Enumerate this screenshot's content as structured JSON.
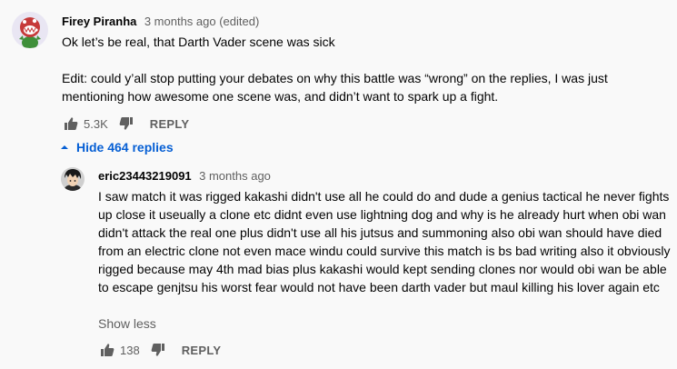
{
  "comment": {
    "author": "Firey Piranha",
    "time": "3 months ago (edited)",
    "text_lines": [
      "Ok let’s be real, that Darth Vader scene was sick",
      "Edit: could y’all stop putting your debates on why this battle was “wrong” on the replies, I was just mentioning how awesome one scene was, and didn’t want to spark up a fight."
    ],
    "likes": "5.3K",
    "reply_label": "REPLY",
    "avatar_icon": "piranha-plant-avatar"
  },
  "replies_toggle": {
    "label": "Hide 464 replies",
    "icon": "chevron-up-icon",
    "color": "#065fd4"
  },
  "reply": {
    "author": "eric23443219091",
    "time": "3 months ago",
    "text": "I saw match it was rigged kakashi didn't use all he could do and dude a genius tactical he never fights up close it useually a clone etc didnt even use lightning dog and why is he already hurt when obi wan didn't attack the real one plus didn't use all his jutsus and summoning also obi wan should have died from an electric clone not even mace windu could survive this match is bs bad writing also it obviously rigged because may 4th mad bias plus kakashi would kept sending clones nor would obi wan be able to escape genjtsu his worst fear would not have been darth vader but maul killing his lover again etc",
    "show_less_label": "Show less",
    "likes": "138",
    "reply_label": "REPLY",
    "avatar_icon": "anime-character-avatar"
  }
}
